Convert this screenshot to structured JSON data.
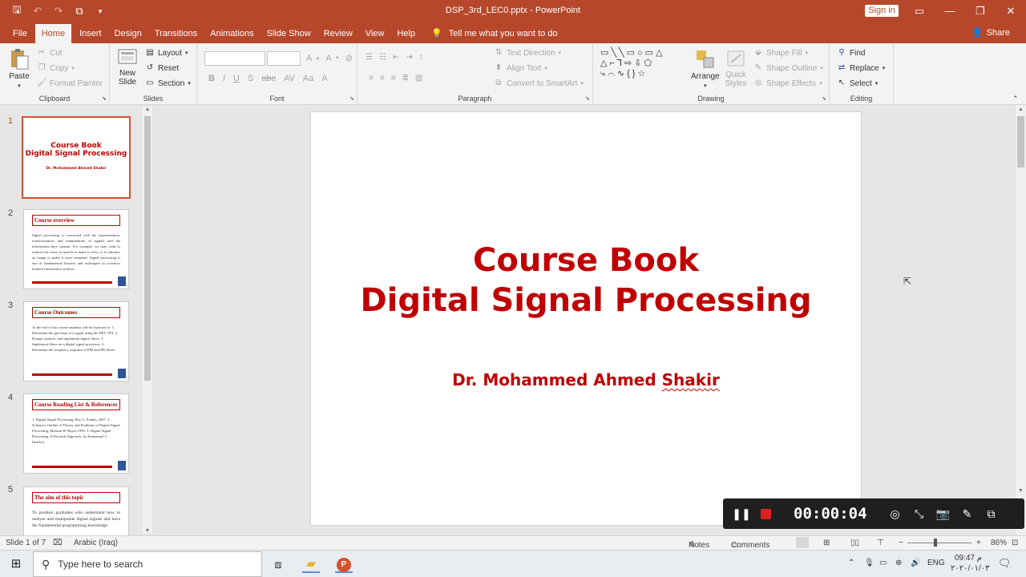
{
  "window": {
    "title": "DSP_3rd_LEC0.pptx  -  PowerPoint",
    "sign_in": "Sign in",
    "minimize": "—",
    "restore": "❐",
    "close": "✕"
  },
  "tabs": [
    "File",
    "Home",
    "Insert",
    "Design",
    "Transitions",
    "Animations",
    "Slide Show",
    "Review",
    "View",
    "Help"
  ],
  "tell_me": "Tell me what you want to do",
  "share": "Share",
  "ribbon": {
    "clipboard": {
      "paste": "Paste",
      "cut": "Cut",
      "copy": "Copy",
      "format_painter": "Format Painter",
      "label": "Clipboard"
    },
    "slides": {
      "new_slide_1": "New",
      "new_slide_2": "Slide",
      "layout": "Layout",
      "reset": "Reset",
      "section": "Section",
      "label": "Slides"
    },
    "font": {
      "label": "Font"
    },
    "paragraph": {
      "text_direction": "Text Direction",
      "align_text": "Align Text",
      "convert_smartart": "Convert to SmartArt",
      "label": "Paragraph"
    },
    "drawing": {
      "arrange": "Arrange",
      "quick_1": "Quick",
      "quick_2": "Styles",
      "shape_fill": "Shape Fill",
      "shape_outline": "Shape Outline",
      "shape_effects": "Shape Effects",
      "label": "Drawing"
    },
    "editing": {
      "find": "Find",
      "replace": "Replace",
      "select": "Select",
      "label": "Editing"
    }
  },
  "thumbnails": [
    {
      "num": "1",
      "title1": "Course Book",
      "title2": "Digital Signal Processing",
      "author": "Dr. Mohammed Ahmed Shakir"
    },
    {
      "num": "2",
      "title": "Course overview",
      "body": "Signal processing is concerned with the representation, transformation, and manipulation of signals and the information they contain. For example, we may wish to remove the noise in speech to make it clear, or to enhance an image to make it more beautiful. Signal processing is one of fundamental theories and techniques to construct modern information systems."
    },
    {
      "num": "3",
      "title": "Course Outcomes",
      "body": "At the end of this course students will be expected to: 1. Determine the spectrum of a signal using the DFT, FFT. 2. Design, analyze, and implement digital filters. 3. Implement filters on a digital signal processor. 4. Determine the frequency response of FIR and IIR filters."
    },
    {
      "num": "4",
      "title": "Course Reading List & References",
      "body": "1. Digital Signal Processing, Roy G. Franks, 2007. 2. Schaum's Outline of Theory and Problems of Digital Signal Processing, Monson H. Hayes 1999. 3. Digital Signal Processing: A Practical Approach, by Emmanuel C. Ifeachor"
    },
    {
      "num": "5",
      "title": "The aim of this topic",
      "body": "To produce graduates who understand how to analyse and manipulate digital signals and have the fundamental programming knowledge"
    }
  ],
  "slide": {
    "title_line1": "Course Book",
    "title_line2": "Digital Signal Processing",
    "author_a": "Dr. Mohammed Ahmed ",
    "author_b": "Shakir"
  },
  "recorder": {
    "time": "00:00:04"
  },
  "status": {
    "slide_of": "Slide 1 of 7",
    "language": "Arabic (Iraq)",
    "notes": "Notes",
    "comments": "Comments",
    "zoom": "86%"
  },
  "taskbar": {
    "search_placeholder": "Type here to search",
    "lang": "ENG",
    "time": "09:47 م",
    "date": "٢٠٢٠/٠١/٠٣"
  },
  "colors": {
    "accent": "#b7472a",
    "title_red": "#c00000",
    "selected_border": "#d35230"
  }
}
